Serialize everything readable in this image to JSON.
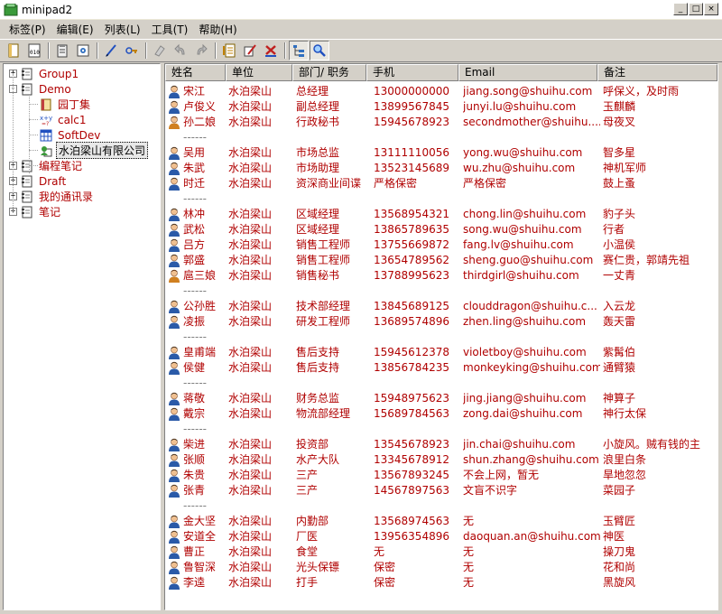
{
  "window": {
    "title": "minipad2"
  },
  "menu": [
    "标签(P)",
    "编辑(E)",
    "列表(L)",
    "工具(T)",
    "帮助(H)"
  ],
  "toolbar": {
    "buttons": [
      {
        "name": "new-icon"
      },
      {
        "name": "properties-icon"
      },
      {
        "sep": true
      },
      {
        "name": "clipboard-icon"
      },
      {
        "name": "settings-icon"
      },
      {
        "sep": true
      },
      {
        "name": "pen-icon"
      },
      {
        "name": "link-icon"
      },
      {
        "sep": true
      },
      {
        "name": "eraser-icon"
      },
      {
        "name": "undo-icon"
      },
      {
        "name": "redo-icon"
      },
      {
        "sep": true
      },
      {
        "name": "list-icon"
      },
      {
        "name": "edit-icon"
      },
      {
        "name": "delete-icon"
      },
      {
        "sep": true
      },
      {
        "name": "tree-view-icon",
        "pressed": true
      },
      {
        "name": "search-icon",
        "pressed": true
      }
    ]
  },
  "tree": [
    {
      "label": "Group1",
      "level": 0,
      "expander": "+",
      "icon": "notebook"
    },
    {
      "label": "Demo",
      "level": 0,
      "expander": "-",
      "icon": "notebook"
    },
    {
      "label": "园丁集",
      "level": 1,
      "icon": "book"
    },
    {
      "label": "calc1",
      "level": 1,
      "icon": "calc"
    },
    {
      "label": "SoftDev",
      "level": 1,
      "icon": "grid"
    },
    {
      "label": "水泊梁山有限公司",
      "level": 1,
      "icon": "contacts",
      "selected": true
    },
    {
      "label": "编程笔记",
      "level": 0,
      "expander": "+",
      "icon": "notebook"
    },
    {
      "label": "Draft",
      "level": 0,
      "expander": "+",
      "icon": "notebook"
    },
    {
      "label": "我的通讯录",
      "level": 0,
      "expander": "+",
      "icon": "notebook"
    },
    {
      "label": "笔记",
      "level": 0,
      "expander": "+",
      "icon": "notebook"
    }
  ],
  "columns": [
    "姓名",
    "单位",
    "部门/ 职务",
    "手机",
    "Email",
    "备注"
  ],
  "rows": [
    {
      "name": "宋江",
      "unit": "水泊梁山",
      "dept": "总经理",
      "phone": "13000000000",
      "email": "jiang.song@shuihu.com",
      "note": "呼保义，及时雨",
      "gender": "m"
    },
    {
      "name": "卢俊义",
      "unit": "水泊梁山",
      "dept": "副总经理",
      "phone": "13899567845",
      "email": "junyi.lu@shuihu.com",
      "note": "玉麒麟",
      "gender": "m"
    },
    {
      "name": "孙二娘",
      "unit": "水泊梁山",
      "dept": "行政秘书",
      "phone": "15945678923",
      "email": "secondmother@shuihu....",
      "note": "母夜叉",
      "gender": "f"
    },
    {
      "sep": "------"
    },
    {
      "name": "吴用",
      "unit": "水泊梁山",
      "dept": "市场总监",
      "phone": "13111110056",
      "email": "yong.wu@shuihu.com",
      "note": "智多星",
      "gender": "m"
    },
    {
      "name": "朱武",
      "unit": "水泊梁山",
      "dept": "市场助理",
      "phone": "13523145689",
      "email": "wu.zhu@shuihu.com",
      "note": "神机军师",
      "gender": "m"
    },
    {
      "name": "时迁",
      "unit": "水泊梁山",
      "dept": "资深商业间谍",
      "phone": "严格保密",
      "email": "严格保密",
      "note": "鼓上蚤",
      "gender": "m"
    },
    {
      "sep": "------"
    },
    {
      "name": "林冲",
      "unit": "水泊梁山",
      "dept": "区域经理",
      "phone": "13568954321",
      "email": "chong.lin@shuihu.com",
      "note": "豹子头",
      "gender": "m"
    },
    {
      "name": "武松",
      "unit": "水泊梁山",
      "dept": "区域经理",
      "phone": "13865789635",
      "email": "song.wu@shuihu.com",
      "note": "行者",
      "gender": "m"
    },
    {
      "name": "吕方",
      "unit": "水泊梁山",
      "dept": "销售工程师",
      "phone": "13755669872",
      "email": "fang.lv@shuihu.com",
      "note": "小温侯",
      "gender": "m"
    },
    {
      "name": "郭盛",
      "unit": "水泊梁山",
      "dept": "销售工程师",
      "phone": "13654789562",
      "email": "sheng.guo@shuihu.com",
      "note": "赛仁贵，郭靖先祖",
      "gender": "m"
    },
    {
      "name": "扈三娘",
      "unit": "水泊梁山",
      "dept": "销售秘书",
      "phone": "13788995623",
      "email": "thirdgirl@shuihu.com",
      "note": "一丈青",
      "gender": "f"
    },
    {
      "sep": "------"
    },
    {
      "name": "公孙胜",
      "unit": "水泊梁山",
      "dept": "技术部经理",
      "phone": "13845689125",
      "email": "clouddragon@shuihu.c...",
      "note": "入云龙",
      "gender": "m"
    },
    {
      "name": "凌振",
      "unit": "水泊梁山",
      "dept": "研发工程师",
      "phone": "13689574896",
      "email": "zhen.ling@shuihu.com",
      "note": "轰天雷",
      "gender": "m"
    },
    {
      "sep": "------"
    },
    {
      "name": "皇甫端",
      "unit": "水泊梁山",
      "dept": "售后支持",
      "phone": "15945612378",
      "email": "violetboy@shuihu.com",
      "note": "紫髯伯",
      "gender": "m"
    },
    {
      "name": "侯健",
      "unit": "水泊梁山",
      "dept": "售后支持",
      "phone": "13856784235",
      "email": "monkeyking@shuihu.com",
      "note": "通臂猿",
      "gender": "m"
    },
    {
      "sep": "------"
    },
    {
      "name": "蒋敬",
      "unit": "水泊梁山",
      "dept": "财务总监",
      "phone": "15948975623",
      "email": "jing.jiang@shuihu.com",
      "note": "神算子",
      "gender": "m"
    },
    {
      "name": "戴宗",
      "unit": "水泊梁山",
      "dept": "物流部经理",
      "phone": "15689784563",
      "email": "zong.dai@shuihu.com",
      "note": "神行太保",
      "gender": "m"
    },
    {
      "sep": "------"
    },
    {
      "name": "柴进",
      "unit": "水泊梁山",
      "dept": "投资部",
      "phone": "13545678923",
      "email": "jin.chai@shuihu.com",
      "note": "小旋风。贼有钱的主",
      "gender": "m"
    },
    {
      "name": "张顺",
      "unit": "水泊梁山",
      "dept": "水产大队",
      "phone": "13345678912",
      "email": "shun.zhang@shuihu.com",
      "note": "浪里白条",
      "gender": "m"
    },
    {
      "name": "朱贵",
      "unit": "水泊梁山",
      "dept": "三产",
      "phone": "13567893245",
      "email": "不会上网，暂无",
      "note": "旱地忽忽",
      "gender": "m"
    },
    {
      "name": "张青",
      "unit": "水泊梁山",
      "dept": "三产",
      "phone": "14567897563",
      "email": "文盲不识字",
      "note": "菜园子",
      "gender": "m"
    },
    {
      "sep": "------"
    },
    {
      "name": "金大坚",
      "unit": "水泊梁山",
      "dept": "内勤部",
      "phone": "13568974563",
      "email": "无",
      "note": "玉臂匠",
      "gender": "m"
    },
    {
      "name": "安道全",
      "unit": "水泊梁山",
      "dept": "厂医",
      "phone": "13956354896",
      "email": "daoquan.an@shuihu.com",
      "note": "神医",
      "gender": "m"
    },
    {
      "name": "曹正",
      "unit": "水泊梁山",
      "dept": "食堂",
      "phone": "无",
      "email": "无",
      "note": "操刀鬼",
      "gender": "m"
    },
    {
      "name": "鲁智深",
      "unit": "水泊梁山",
      "dept": "光头保镖",
      "phone": "保密",
      "email": "无",
      "note": "花和尚",
      "gender": "m"
    },
    {
      "name": "李逵",
      "unit": "水泊梁山",
      "dept": "打手",
      "phone": "保密",
      "email": "无",
      "note": "黑旋风",
      "gender": "m"
    }
  ]
}
